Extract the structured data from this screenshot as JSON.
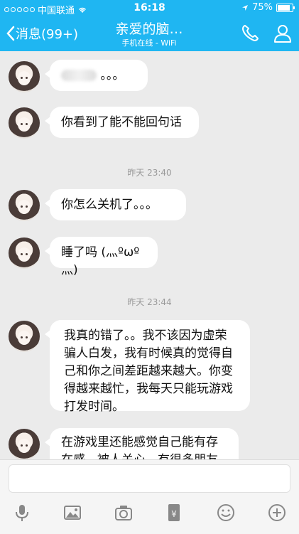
{
  "status": {
    "carrier": "中国联通",
    "time": "16:18",
    "battery": "75%",
    "battery_level": 0.75
  },
  "nav": {
    "back_label": "消息(99+)",
    "title": "亲爱的脑…",
    "subtitle": "手机在线 - WiFi"
  },
  "messages": [
    {
      "type": "blurred",
      "text": "。。。"
    },
    {
      "type": "text",
      "text": "你看到了能不能回句话"
    },
    {
      "type": "timestamp",
      "text": "昨天 23:40"
    },
    {
      "type": "text",
      "text": "你怎么关机了。。。"
    },
    {
      "type": "text",
      "text": "睡了吗 (灬ºωº灬)"
    },
    {
      "type": "timestamp",
      "text": "昨天 23:44"
    },
    {
      "type": "text",
      "text": "我真的错了。。我不该因为虚荣骗人白发，我有时候真的觉得自己和你之间差距越来越大。你变得越来越忙，我每天只能玩游戏打发时间。"
    },
    {
      "type": "text",
      "text": "在游戏里还能感觉自己能有存在感，被人关心，有很多朋友"
    }
  ],
  "toolbar": [
    "microphone-icon",
    "image-icon",
    "camera-icon",
    "red-packet-icon",
    "emoji-icon",
    "plus-icon"
  ]
}
